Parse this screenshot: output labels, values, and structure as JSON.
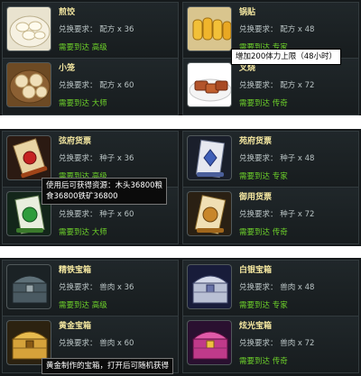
{
  "groups": [
    {
      "items": [
        {
          "title": "煎饺",
          "requirement": "兑换要求：  配方 x 36",
          "need": "需要到达 高级",
          "icon": "dumplings-icon"
        },
        {
          "title": "锅贴",
          "requirement": "兑换要求：  配方 x 48",
          "need": "需要到达 专家",
          "icon": "potstickers-icon"
        },
        {
          "title": "小笼",
          "requirement": "兑换要求：  配方 x 60",
          "need": "需要到达 大师",
          "icon": "steamed-buns-icon"
        },
        {
          "title": "叉烧",
          "requirement": "兑换要求：  配方 x 72",
          "need": "需要到达 传奇",
          "icon": "char-siu-icon"
        }
      ]
    },
    {
      "items": [
        {
          "title": "弦府货票",
          "requirement": "兑换要求：  种子 x 36",
          "need": "需要到达 高级",
          "icon": "scroll-red-icon"
        },
        {
          "title": "苑府货票",
          "requirement": "兑换要求：  种子 x 48",
          "need": "需要到达 专家",
          "icon": "scroll-blue-icon"
        },
        {
          "title": "",
          "requirement": "兑换要求：  种子 x 60",
          "need": "需要到达 大师",
          "icon": "scroll-green-icon"
        },
        {
          "title": "御用货票",
          "requirement": "兑换要求：  种子 x 72",
          "need": "需要到达 传奇",
          "icon": "scroll-gold-icon"
        }
      ]
    },
    {
      "items": [
        {
          "title": "精铁宝箱",
          "requirement": "兑换要求：  兽肉 x 36",
          "need": "需要到达 高级",
          "icon": "iron-chest-icon"
        },
        {
          "title": "白银宝箱",
          "requirement": "兑换要求：  兽肉 x 48",
          "need": "需要到达 专家",
          "icon": "silver-chest-icon"
        },
        {
          "title": "黄金宝箱",
          "requirement": "兑换要求：  兽肉 x 60",
          "need": "",
          "icon": "gold-chest-icon"
        },
        {
          "title": "炫光宝箱",
          "requirement": "兑换要求：  兽肉 x 72",
          "need": "需要到达 传奇",
          "icon": "dazzling-chest-icon"
        }
      ]
    }
  ],
  "tooltips": {
    "stamina": "增加200体力上限（48小时）",
    "resources_line1": "使用后可获得资源：木头36800粮",
    "resources_line2": "食36800铁矿36800",
    "gold_chest": "黄金制作的宝箱，打开后可随机获得"
  }
}
